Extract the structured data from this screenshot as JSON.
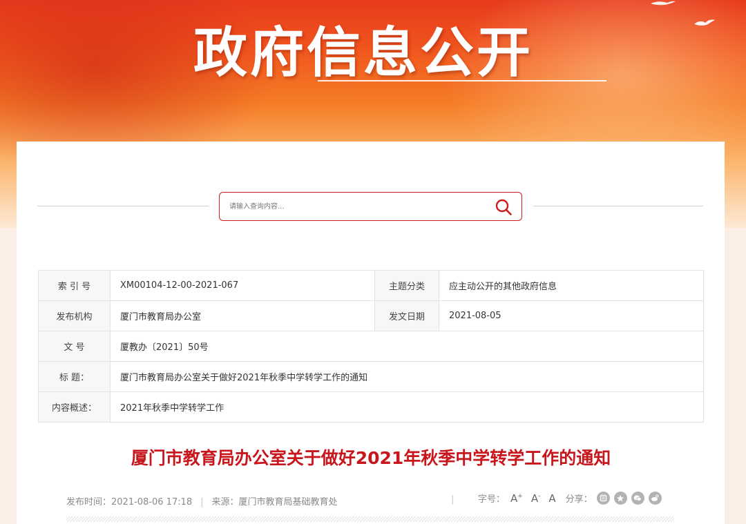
{
  "banner": {
    "title": "政府信息公开"
  },
  "search": {
    "placeholder": "请输入查询内容..."
  },
  "meta": {
    "index_label": "索 引 号",
    "index_value": "XM00104-12-00-2021-067",
    "category_label": "主题分类",
    "category_value": "应主动公开的其他政府信息",
    "publisher_label": "发布机构",
    "publisher_value": "厦门市教育局办公室",
    "date_label": "发文日期",
    "date_value": "2021-08-05",
    "docno_label": "文 号",
    "docno_value": "厦教办〔2021〕50号",
    "title_label": "标 题：",
    "title_value": "厦门市教育局办公室关于做好2021年秋季中学转学工作的通知",
    "summary_label": "内容概述：",
    "summary_value": "2021年秋季中学转学工作"
  },
  "article": {
    "title": "厦门市教育局办公室关于做好2021年秋季中学转学工作的通知",
    "publish_time": "发布时间：2021-08-06 17:18",
    "source": "来源：厦门市教育局基础教育处",
    "font_size_label": "字号：",
    "font_large": "A",
    "font_small": "A",
    "font_normal": "A",
    "share_label": "分享："
  },
  "share_icons": [
    "weibo-icon",
    "qzone-icon",
    "wechat-icon",
    "sina-icon"
  ],
  "colors": {
    "accent": "#c8161d",
    "banner_red": "#e73b1d",
    "banner_orange": "#f57c26"
  }
}
